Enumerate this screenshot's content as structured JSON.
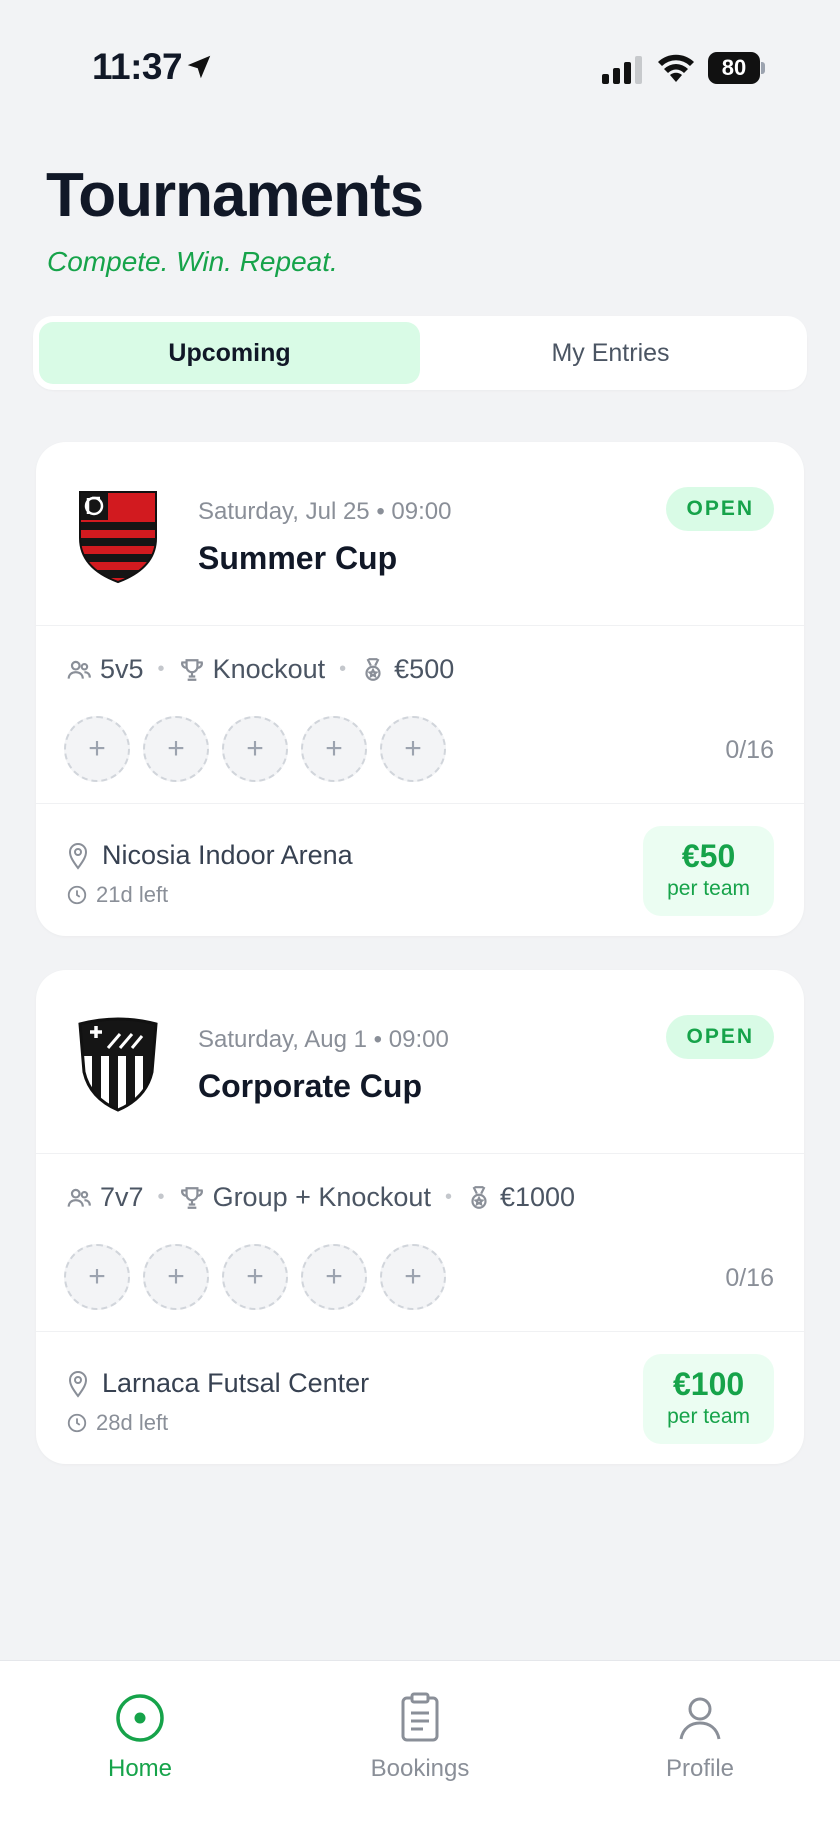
{
  "status_bar": {
    "time": "11:37",
    "battery": "80"
  },
  "header": {
    "title": "Tournaments",
    "tagline": "Compete. Win. Repeat."
  },
  "tabs": [
    {
      "label": "Upcoming",
      "active": true
    },
    {
      "label": "My Entries",
      "active": false
    }
  ],
  "tournaments": [
    {
      "date": "Saturday, Jul 25 • 09:00",
      "name": "Summer Cup",
      "status": "OPEN",
      "format": "5v5",
      "type": "Knockout",
      "prize": "€500",
      "slot_symbol": "+",
      "slots_filled": "0/16",
      "venue": "Nicosia Indoor Arena",
      "time_left": "21d left",
      "price": "€50",
      "price_unit": "per team",
      "crest_icon": "flamengo-crest-icon"
    },
    {
      "date": "Saturday, Aug 1 • 09:00",
      "name": "Corporate Cup",
      "status": "OPEN",
      "format": "7v7",
      "type": "Group + Knockout",
      "prize": "€1000",
      "slot_symbol": "+",
      "slots_filled": "0/16",
      "venue": "Larnaca Futsal Center",
      "time_left": "28d left",
      "price": "€100",
      "price_unit": "per team",
      "crest_icon": "sfc-crest-icon"
    }
  ],
  "bottom_nav": [
    {
      "label": "Home",
      "icon": "home-target-icon",
      "active": true
    },
    {
      "label": "Bookings",
      "icon": "clipboard-icon",
      "active": false
    },
    {
      "label": "Profile",
      "icon": "person-icon",
      "active": false
    }
  ],
  "colors": {
    "accent": "#16a34a",
    "accent_soft": "#d9fbe6",
    "background": "#f2f3f5"
  }
}
